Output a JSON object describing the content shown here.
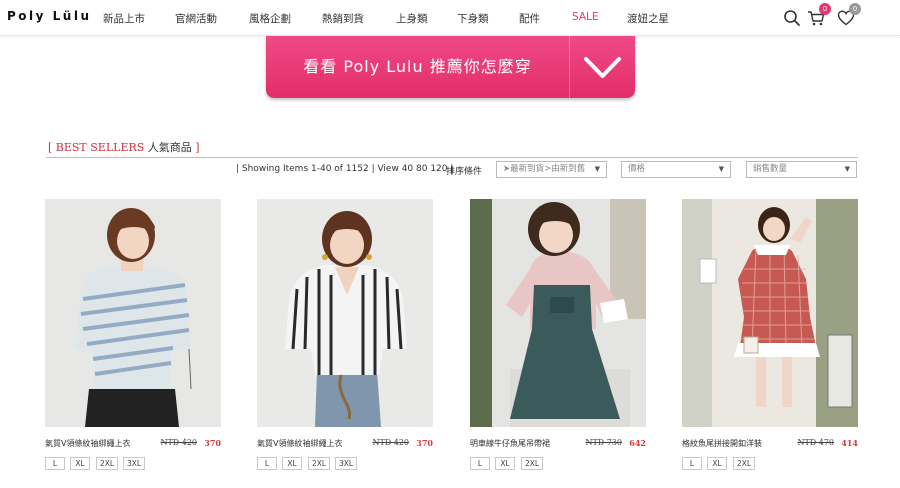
{
  "header": {
    "logo": "Poly Lülu",
    "nav": [
      "新品上市",
      "官網活動",
      "風格企劃",
      "熱銷到貨",
      "上身類",
      "下身類",
      "配件",
      "SALE",
      "渡妞之星"
    ],
    "cart_count": "0",
    "wishlist_count": "0"
  },
  "hero": {
    "label": "看看 Poly Lulu 推薦你怎麼穿"
  },
  "section": {
    "title_en": "[ BEST SELLERS ",
    "title_zh": "人氣商品",
    "title_end": " ]"
  },
  "toolbar": {
    "info": "| Showing Items 1-40 of 1152 | View 40 80 120 |",
    "sort_label": "排序條件",
    "sort_select": "➤最新到貨>由新到舊",
    "price_select": "價格",
    "sales_select": "銷售數量"
  },
  "products": [
    {
      "name": "氣質V領條紋袖綁繩上衣",
      "old_price": "NTD 420",
      "price": "370",
      "sizes": [
        "L",
        "XL",
        "2XL",
        "3XL"
      ]
    },
    {
      "name": "氣質V領條紋袖綁繩上衣",
      "old_price": "NTD 420",
      "price": "370",
      "sizes": [
        "L",
        "XL",
        "2XL",
        "3XL"
      ]
    },
    {
      "name": "明車線牛仔魚尾吊帶裙",
      "old_price": "NTD 730",
      "price": "642",
      "sizes": [
        "L",
        "XL",
        "2XL"
      ]
    },
    {
      "name": "格紋魚尾拼接開釦洋裝",
      "old_price": "NTD 470",
      "price": "414",
      "sizes": [
        "L",
        "XL",
        "2XL"
      ]
    }
  ],
  "colors": {
    "brand_pink": "#e8356f",
    "sale": "#e03a6b",
    "price_red": "#d13a3a",
    "badge": "#e8356f"
  }
}
